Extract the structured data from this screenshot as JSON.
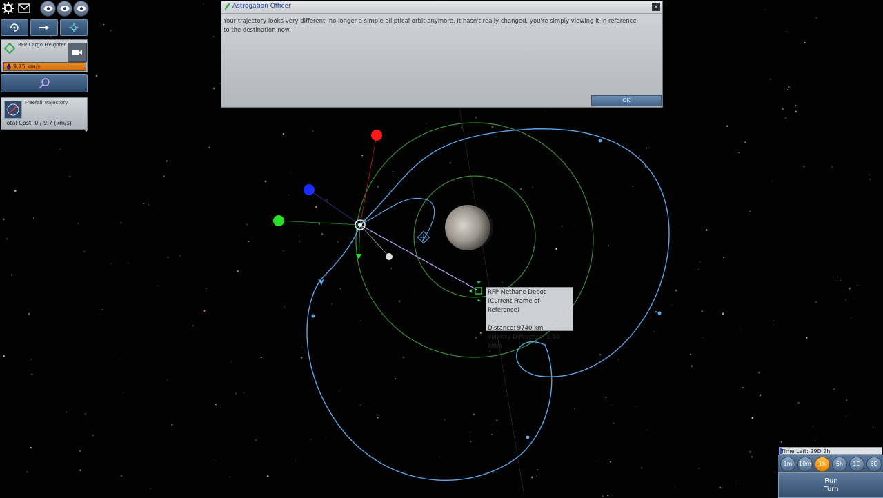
{
  "toolbar": {
    "icons": [
      "gear-icon",
      "mail-icon",
      "eye-icon",
      "eye-icon",
      "eye-icon"
    ],
    "row2_icons": [
      "orbit-refresh-icon",
      "ship-fleet-icon",
      "target-select-icon"
    ]
  },
  "ship_card": {
    "name": "RFP Cargo Freighter",
    "delta_v": "9.75 km/s",
    "fuel_fraction": 1.0
  },
  "trajectory_card": {
    "name": "Freefall Trajectory",
    "cost": "Total Cost: 0 / 9.7 (km/s)"
  },
  "dialog": {
    "title": "Astrogation Officer",
    "body": "Your trajectory looks very different, no longer a simple elliptical orbit anymore. It hasn't really changed, you're simply viewing it in reference to the destination now.",
    "ok_label": "OK",
    "close_label": "x"
  },
  "tooltip": {
    "line1": "RFP Methane Depot",
    "line2": "(Current Frame of Reference)",
    "line3": "Distance: 9740 km",
    "line4": "Velocity Difference: 1.50 km/s"
  },
  "time_controls": {
    "time_left": "Time Left: 29D 2h",
    "steps": [
      "1m",
      "10m",
      "1h",
      "6h",
      "1D",
      "6D"
    ],
    "active_step": "1h",
    "run_line1": "Run",
    "run_line2": "Turn"
  },
  "colors": {
    "trajectory": "#5aa6e8",
    "orbit": "#3d8a3a",
    "prograde_marker": "#ff1a1a",
    "normal_marker": "#1a2cff",
    "radial_marker": "#27e027",
    "fuel_bar": "#f28a1c",
    "active_time": "#f5a623"
  }
}
